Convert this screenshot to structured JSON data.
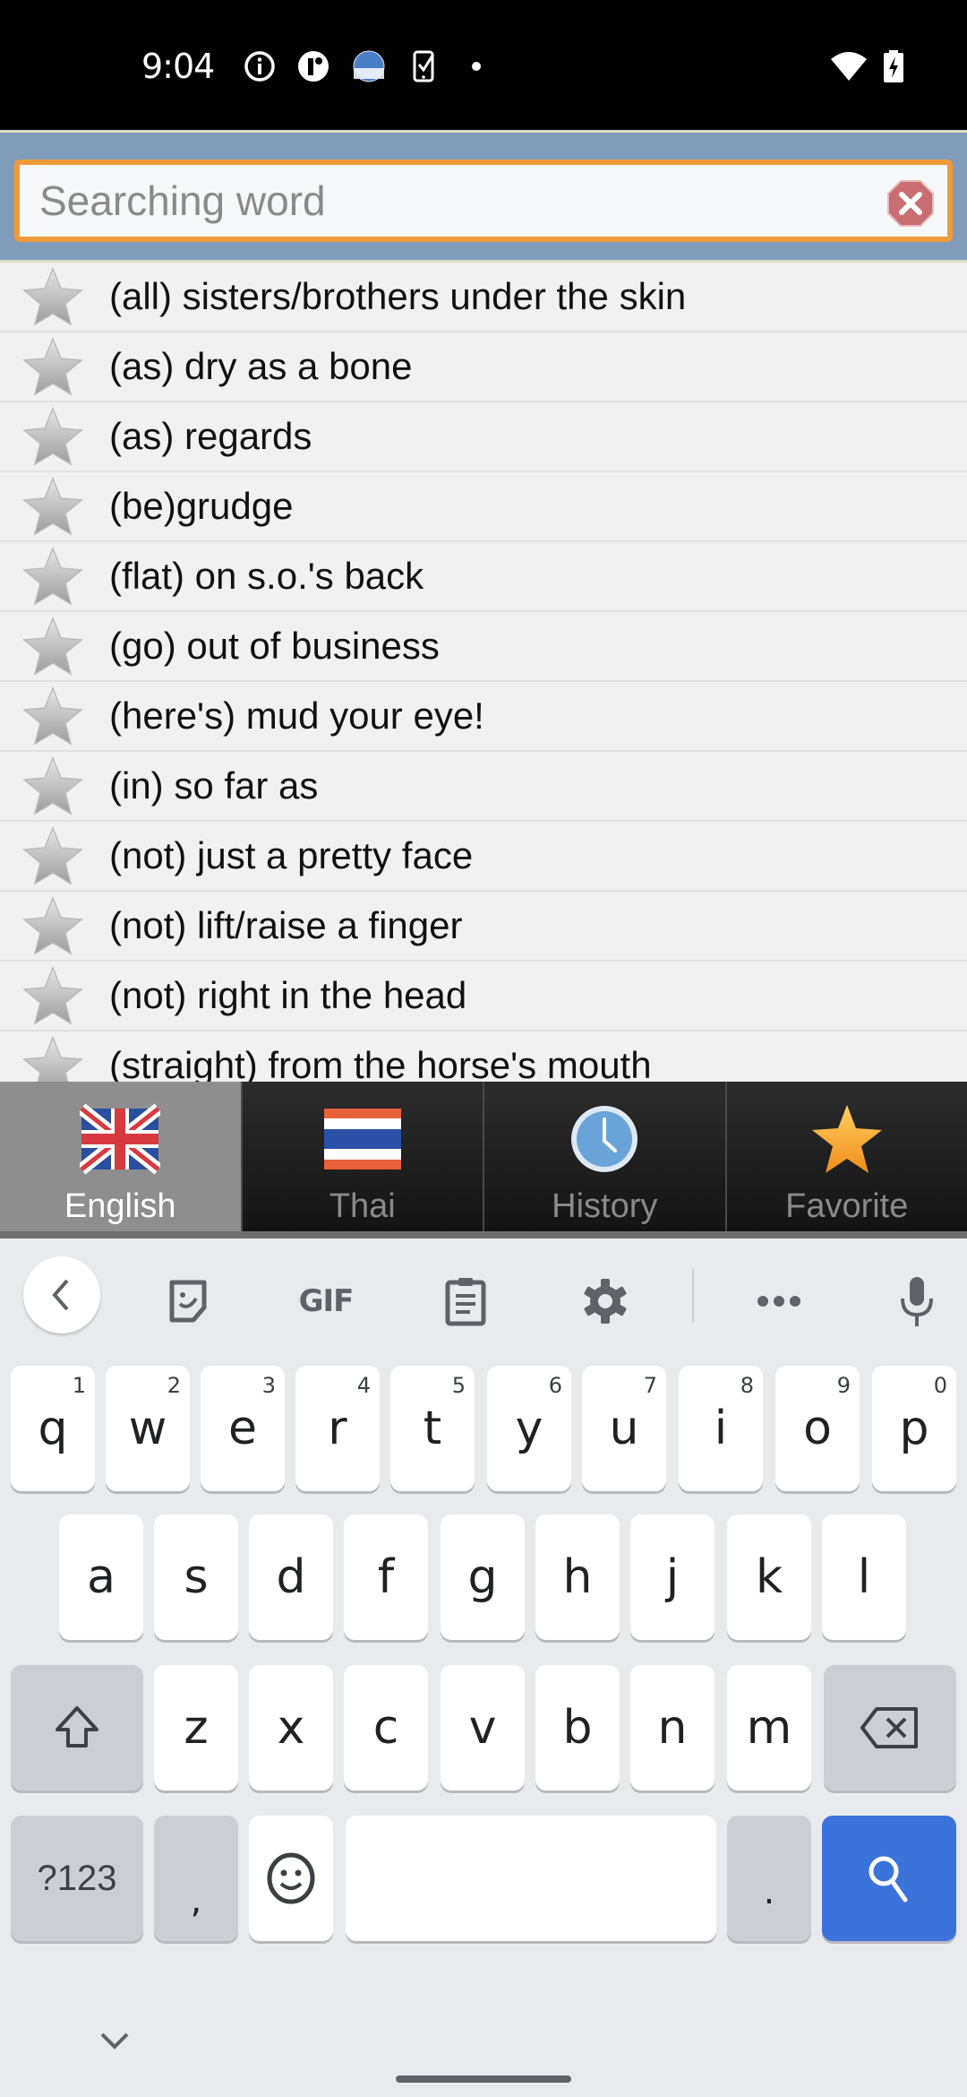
{
  "status_bar": {
    "time": "9:04",
    "left_icons": [
      "info-icon",
      "notification-app-icon",
      "test-app-icon",
      "device-check-icon",
      "dot-indicator-icon"
    ],
    "right_icons": [
      "wifi-icon",
      "battery-charging-icon"
    ]
  },
  "search": {
    "placeholder": "Searching word",
    "value": "",
    "clear_icon": "clear-stop-icon"
  },
  "word_list": {
    "items": [
      {
        "word": "(all) sisters/brothers under the skin",
        "favorite": false
      },
      {
        "word": "(as) dry as a bone",
        "favorite": false
      },
      {
        "word": "(as) regards",
        "favorite": false
      },
      {
        "word": "(be)grudge",
        "favorite": false
      },
      {
        "word": "(flat) on s.o.'s back",
        "favorite": false
      },
      {
        "word": "(go) out of business",
        "favorite": false
      },
      {
        "word": "(here's) mud your eye!",
        "favorite": false
      },
      {
        "word": "(in) so far as",
        "favorite": false
      },
      {
        "word": "(not) just a pretty face",
        "favorite": false
      },
      {
        "word": "(not) lift/raise a finger",
        "favorite": false
      },
      {
        "word": "(not) right in the head",
        "favorite": false
      },
      {
        "word": "(straight) from the horse's mouth",
        "favorite": false
      }
    ]
  },
  "tabs": [
    {
      "label": "English",
      "icon": "uk-flag-icon",
      "active": true
    },
    {
      "label": "Thai",
      "icon": "thai-flag-icon",
      "active": false
    },
    {
      "label": "History",
      "icon": "clock-icon",
      "active": false
    },
    {
      "label": "Favorite",
      "icon": "star-icon",
      "active": false
    }
  ],
  "keyboard": {
    "toolbar": [
      "back-icon",
      "sticker-icon",
      "GIF",
      "clipboard-icon",
      "settings-icon",
      "more-icon",
      "mic-icon"
    ],
    "gif_label": "GIF",
    "row1": [
      {
        "key": "q",
        "hint": "1"
      },
      {
        "key": "w",
        "hint": "2"
      },
      {
        "key": "e",
        "hint": "3"
      },
      {
        "key": "r",
        "hint": "4"
      },
      {
        "key": "t",
        "hint": "5"
      },
      {
        "key": "y",
        "hint": "6"
      },
      {
        "key": "u",
        "hint": "7"
      },
      {
        "key": "i",
        "hint": "8"
      },
      {
        "key": "o",
        "hint": "9"
      },
      {
        "key": "p",
        "hint": "0"
      }
    ],
    "row2": [
      "a",
      "s",
      "d",
      "f",
      "g",
      "h",
      "j",
      "k",
      "l"
    ],
    "row3": [
      "z",
      "x",
      "c",
      "v",
      "b",
      "n",
      "m"
    ],
    "symbols_label": "?123",
    "comma": ",",
    "period": ".",
    "accent_color": "#3b73db"
  }
}
